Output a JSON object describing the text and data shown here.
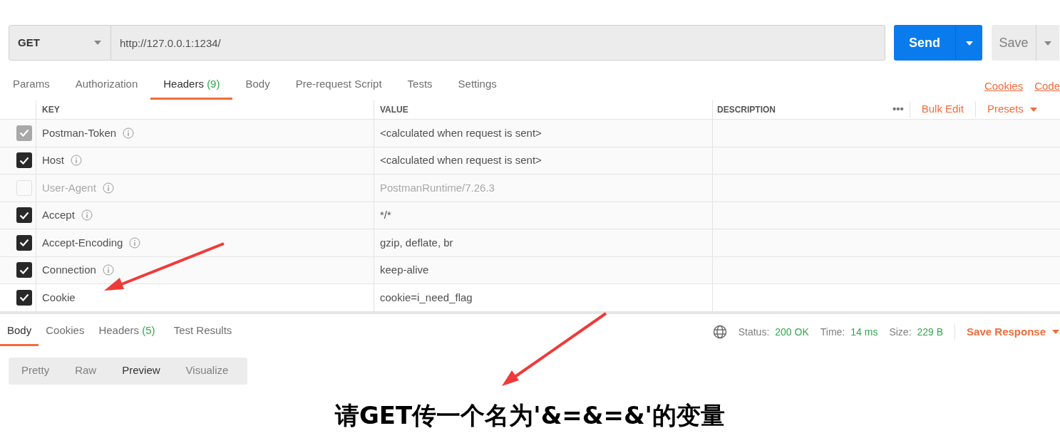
{
  "request": {
    "method": "GET",
    "url": "http://127.0.0.1:1234/",
    "send_label": "Send",
    "save_label": "Save"
  },
  "tabs": [
    {
      "label": "Params",
      "selected": false
    },
    {
      "label": "Authorization",
      "selected": false
    },
    {
      "label": "Headers",
      "count": "(9)",
      "selected": true
    },
    {
      "label": "Body",
      "selected": false
    },
    {
      "label": "Pre-request Script",
      "selected": false
    },
    {
      "label": "Tests",
      "selected": false
    },
    {
      "label": "Settings",
      "selected": false
    }
  ],
  "tab_links": [
    "Cookies",
    "Code"
  ],
  "table": {
    "columns": [
      "KEY",
      "VALUE",
      "DESCRIPTION"
    ],
    "more": "•••",
    "bulk_edit": "Bulk Edit",
    "presets": "Presets",
    "rows": [
      {
        "key": "Postman-Token",
        "value": "<calculated when request is sent>",
        "checked": true,
        "disabled": true,
        "info": true
      },
      {
        "key": "Host",
        "value": "<calculated when request is sent>",
        "checked": true,
        "disabled": false,
        "info": true
      },
      {
        "key": "User-Agent",
        "value": "PostmanRuntime/7.26.3",
        "checked": false,
        "disabled": false,
        "info": true
      },
      {
        "key": "Accept",
        "value": "*/*",
        "checked": true,
        "disabled": false,
        "info": true
      },
      {
        "key": "Accept-Encoding",
        "value": "gzip, deflate, br",
        "checked": true,
        "disabled": false,
        "info": true
      },
      {
        "key": "Connection",
        "value": "keep-alive",
        "checked": true,
        "disabled": false,
        "info": true
      },
      {
        "key": "Cookie",
        "value": "cookie=i_need_flag",
        "checked": true,
        "disabled": false,
        "info": false
      }
    ]
  },
  "response": {
    "tabs": [
      {
        "label": "Body",
        "selected": true
      },
      {
        "label": "Cookies",
        "selected": false
      },
      {
        "label": "Headers",
        "count": "(5)",
        "selected": false
      },
      {
        "label": "Test Results",
        "selected": false
      }
    ],
    "stats": [
      {
        "label": "Status:",
        "value": "200 OK"
      },
      {
        "label": "Time:",
        "value": "14 ms"
      },
      {
        "label": "Size:",
        "value": "229 B"
      }
    ],
    "save_response": "Save Response",
    "views": [
      {
        "label": "Pretty",
        "selected": false
      },
      {
        "label": "Raw",
        "selected": false
      },
      {
        "label": "Preview",
        "selected": true
      },
      {
        "label": "Visualize",
        "selected": false
      }
    ],
    "preview_text": "请GET传一个名为'&=&=&'的变量"
  }
}
